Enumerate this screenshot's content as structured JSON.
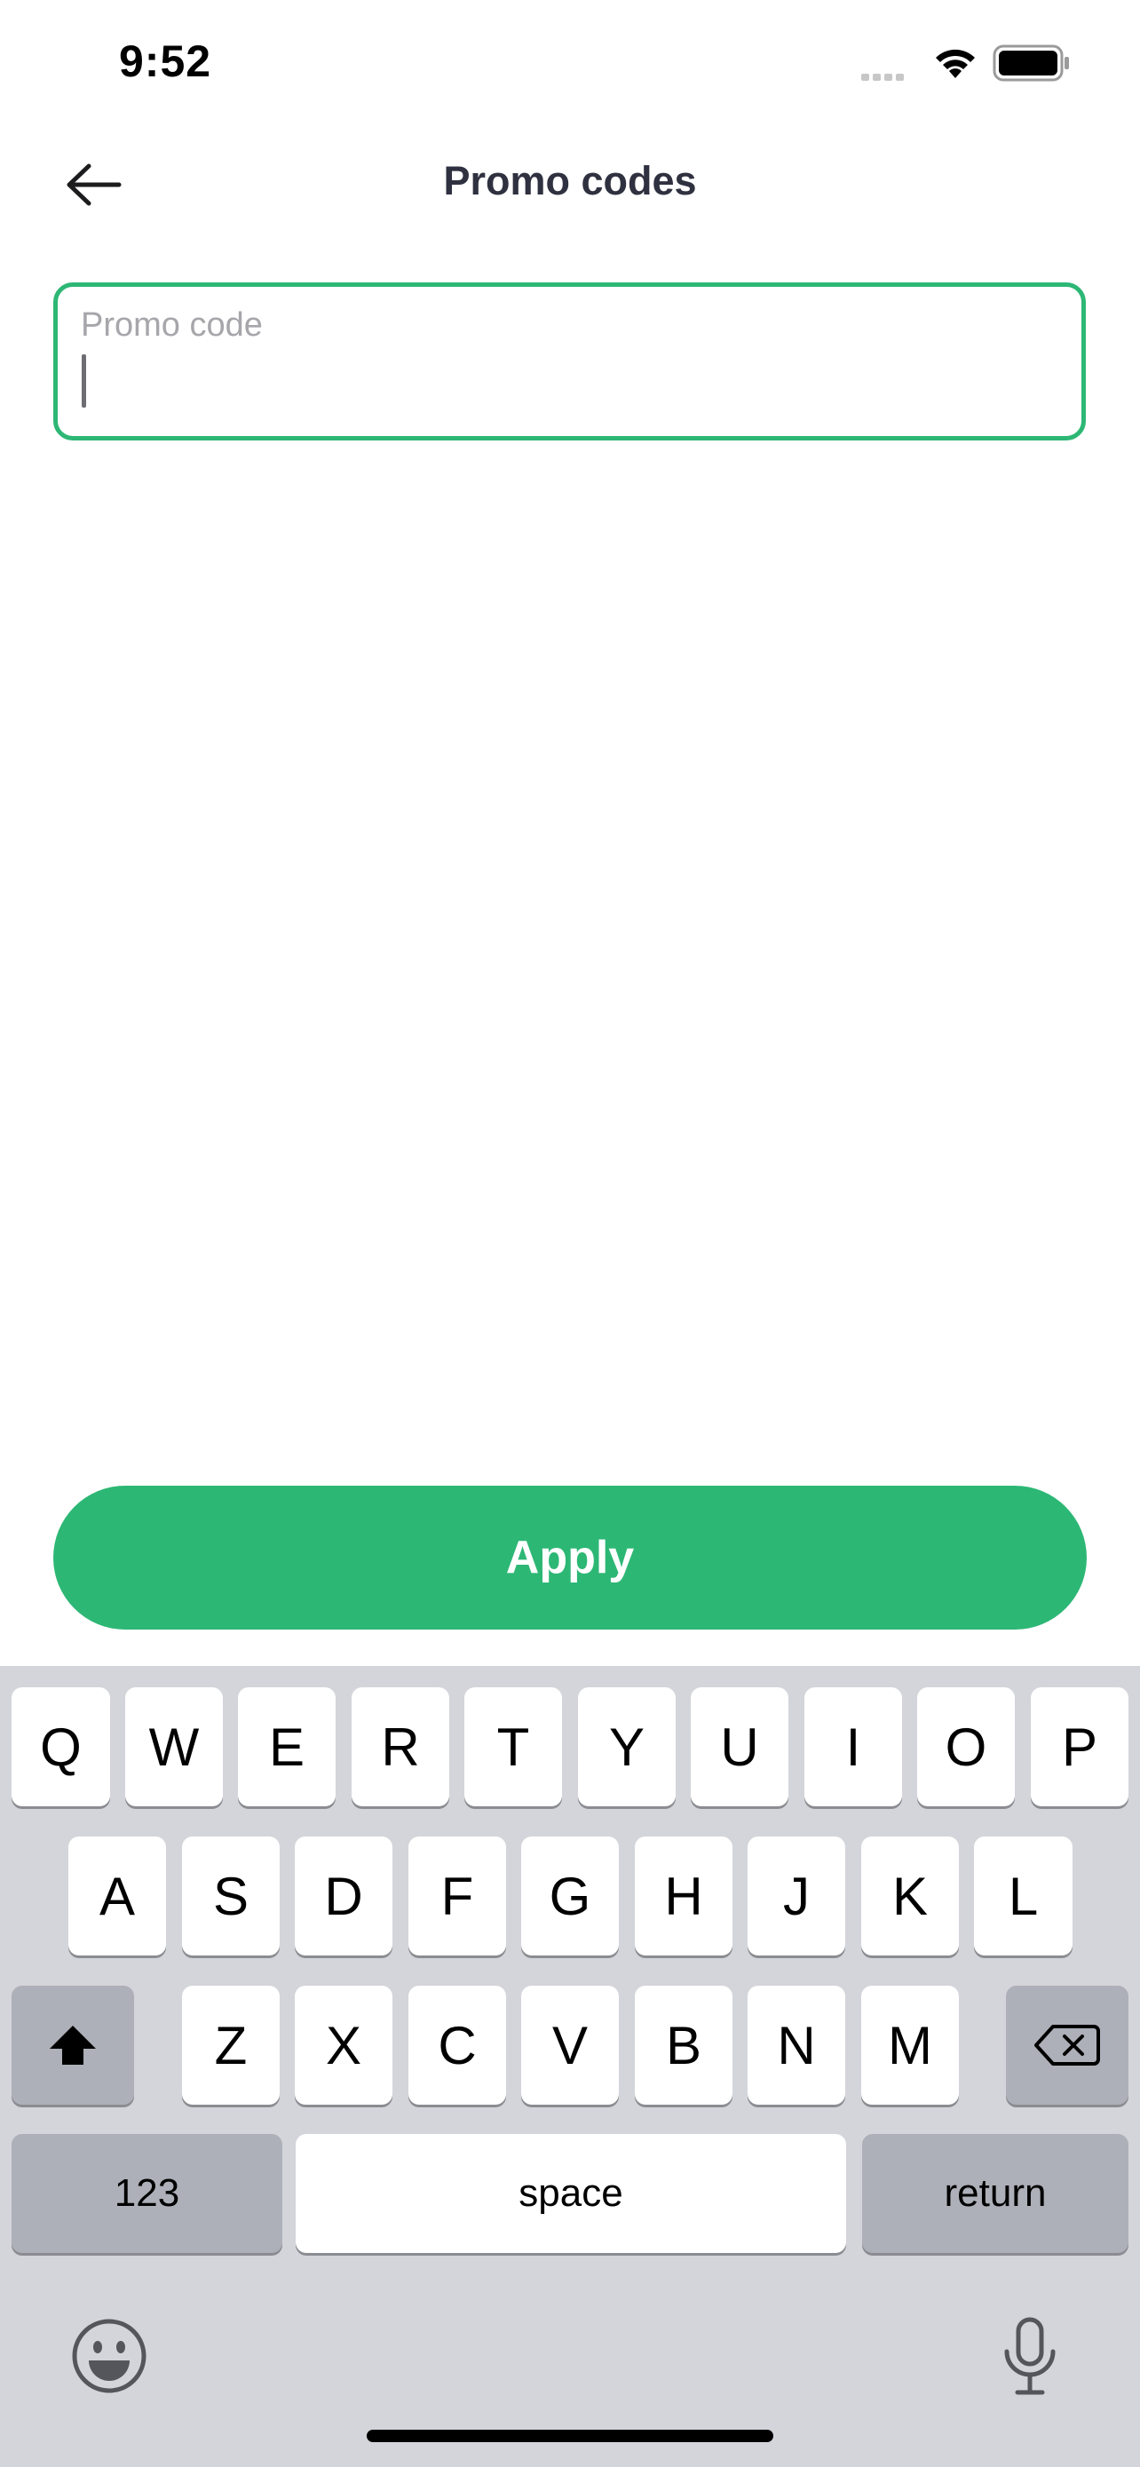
{
  "status_bar": {
    "time": "9:52"
  },
  "header": {
    "title": "Promo codes"
  },
  "promo_field": {
    "label": "Promo code",
    "value": ""
  },
  "apply_button": {
    "label": "Apply"
  },
  "colors": {
    "accent": "#2db775",
    "title_text": "#2f3140",
    "keyboard_bg": "#d4d5da"
  },
  "keyboard": {
    "row1": [
      "Q",
      "W",
      "E",
      "R",
      "T",
      "Y",
      "U",
      "I",
      "O",
      "P"
    ],
    "row2": [
      "A",
      "S",
      "D",
      "F",
      "G",
      "H",
      "J",
      "K",
      "L"
    ],
    "row3": [
      "Z",
      "X",
      "C",
      "V",
      "B",
      "N",
      "M"
    ],
    "numbers_label": "123",
    "space_label": "space",
    "return_label": "return",
    "icons": [
      "shift-icon",
      "delete-icon",
      "emoji-icon",
      "microphone-icon"
    ]
  }
}
